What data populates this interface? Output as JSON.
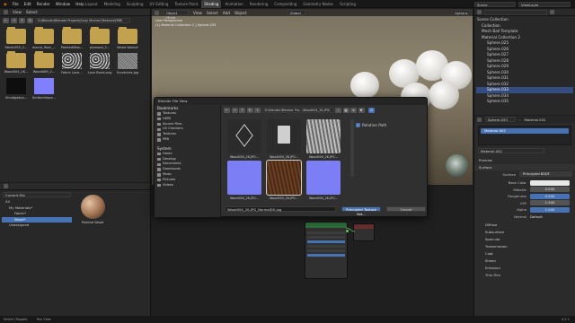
{
  "topbar": {
    "menus": [
      "File",
      "Edit",
      "Render",
      "Window",
      "Help"
    ],
    "tabs": [
      "Layout",
      "Modeling",
      "Sculpting",
      "UV Editing",
      "Texture Paint",
      "Shading",
      "Animation",
      "Rendering",
      "Compositing",
      "Geometry Nodes",
      "Scripting"
    ],
    "active_tab": "Shading",
    "scene_label": "Scene",
    "view_layer_label": "ViewLayer"
  },
  "file_browser": {
    "menu": [
      "View",
      "Select"
    ],
    "path": "D:\\Blender\\Blender Projects\\Cozy Kitchen\\Textures\\PBR\\",
    "assets": [
      {
        "label": "Fabric055_2...",
        "kind": "folder"
      },
      {
        "label": "macro_floor_...",
        "kind": "folder"
      },
      {
        "label": "PaintedWoo...",
        "kind": "folder"
      },
      {
        "label": "plywood_2...",
        "kind": "folder"
      },
      {
        "label": "Wood Walnut",
        "kind": "folder"
      },
      {
        "label": "Wood004_2K...",
        "kind": "folder"
      },
      {
        "label": "Wood089_2...",
        "kind": "folder"
      },
      {
        "label": "Fabric Lace...",
        "kind": "lace"
      },
      {
        "label": "Lace Band.png",
        "kind": "lace"
      },
      {
        "label": "Scratches.jpg",
        "kind": "noise"
      },
      {
        "label": "SmudgesLa...",
        "kind": "dark"
      },
      {
        "label": "SurfaceImpe...",
        "kind": "normal"
      }
    ]
  },
  "asset_browser": {
    "library": "Current File",
    "tree": [
      "All",
      "My Materials*",
      "Fabric*",
      "Wood*",
      "Unassigned"
    ],
    "selected": "Wood*",
    "preview_label": "Painted Wood"
  },
  "viewport": {
    "mode": "Object Mode",
    "menus": [
      "View",
      "Select",
      "Add",
      "Object"
    ],
    "transform": "Global",
    "options": "Options",
    "info_line1": "User Perspective",
    "info_line2": "(1) Material Collection 2 | Sphere.033"
  },
  "outliner": {
    "items": [
      "Scene Collection",
      "Collection",
      "Mesh Ball Template",
      "Material Collection 2",
      "Sphere.025",
      "Sphere.026",
      "Sphere.027",
      "Sphere.028",
      "Sphere.029",
      "Sphere.030",
      "Sphere.031",
      "Sphere.032",
      "Sphere.033",
      "Sphere.034",
      "Sphere.035"
    ],
    "selected": "Sphere.033"
  },
  "properties": {
    "object": "Sphere.033",
    "material_slot": "Material.002",
    "slot_entry": "Material.002",
    "material_field": "Material.002",
    "sections": [
      "Preview",
      "Surface"
    ],
    "surface_value": "Principled BSDF",
    "rows": [
      {
        "label": "Base Color",
        "value": "",
        "kind": "color"
      },
      {
        "label": "Metallic",
        "value": "0.000",
        "kind": "num"
      },
      {
        "label": "Roughness",
        "value": "0.500",
        "kind": "blue"
      },
      {
        "label": "IOR",
        "value": "1.500",
        "kind": "num"
      },
      {
        "label": "Alpha",
        "value": "1.000",
        "kind": "blue"
      }
    ],
    "normal_label": "Normal",
    "normal_value": "Default",
    "subsections": [
      "Diffuse",
      "Subsurface",
      "Specular",
      "Transmission",
      "Coat",
      "Sheen",
      "Emission",
      "Thin Film"
    ]
  },
  "dialog": {
    "title": "Blender File View",
    "bookmarks_label": "Bookmarks",
    "bookmarks": [
      "Textures",
      "HDRI",
      "Source Files",
      "UV Checkers",
      "Textures",
      "PBR"
    ],
    "system_label": "System",
    "system": [
      "Home",
      "Desktop",
      "Documents",
      "Downloads",
      "Music",
      "Pictures",
      "Videos"
    ],
    "path": "D:\\Blender\\Blender Pro...\\Wood004_2K-JPG\\",
    "files": [
      {
        "label": "Wood004_2K-JPG...",
        "kind": "box"
      },
      {
        "label": "Wood004_2K-JPG...",
        "kind": "file"
      },
      {
        "label": "Wood004_2K-JPG...",
        "kind": "gray"
      },
      {
        "label": "Wood004_2K-JPG...",
        "kind": "normal"
      },
      {
        "label": "Wood004_2K-JPG...",
        "kind": "wood"
      },
      {
        "label": "Wood004_2K-JPG...",
        "kind": "normal"
      }
    ],
    "relative_path_label": "Relative Path",
    "filename": "Wood004_2K-JPG_NormalDX.jpg",
    "confirm": "Principled Texture Set...",
    "cancel": "Cancel"
  },
  "statusbar": {
    "left": "Select (Toggle)",
    "middle": "Pan View",
    "right": "4.2.1"
  }
}
